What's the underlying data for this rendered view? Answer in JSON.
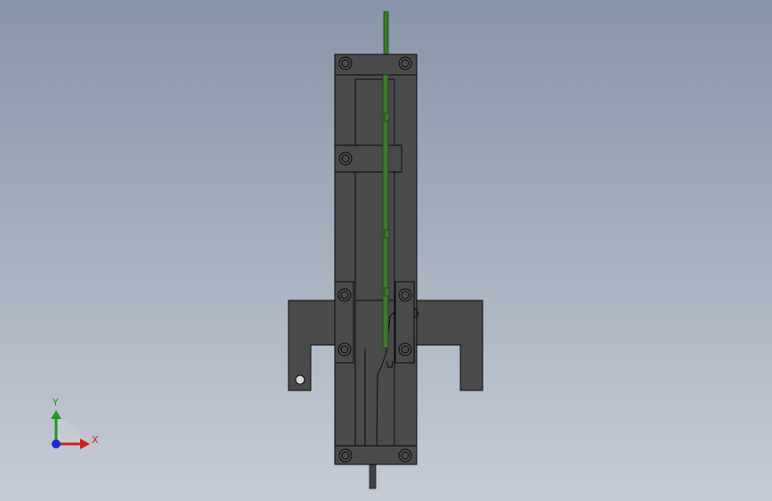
{
  "viewport": {
    "background_top": "#8795a8",
    "background_bottom": "#c6ccd6"
  },
  "model": {
    "part_color": "#4a4a4a",
    "edge_color": "#0b0b0b",
    "rod_color": "#3b7a2a",
    "lower_rod_color": "#3f4248",
    "hole_color": "#d8d8d8"
  },
  "triad": {
    "x_label": "X",
    "y_label": "Y",
    "x_color": "#d0201a",
    "y_color": "#1f9a1f",
    "z_color": "#1f2bd0"
  }
}
